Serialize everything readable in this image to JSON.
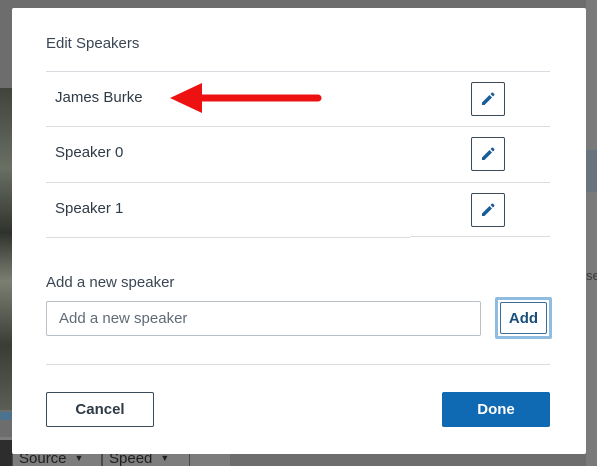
{
  "background": {
    "bottom_buttons": [
      "Source",
      "Speed"
    ],
    "right_text": "se"
  },
  "modal": {
    "title": "Edit Speakers",
    "speakers": [
      {
        "name": "James Burke",
        "edit_icon": "pencil-icon"
      },
      {
        "name": "Speaker 0",
        "edit_icon": "pencil-icon"
      },
      {
        "name": "Speaker 1",
        "edit_icon": "pencil-icon"
      }
    ],
    "add_section": {
      "label": "Add a new speaker",
      "input_placeholder": "Add a new speaker",
      "input_value": "",
      "add_button": "Add"
    },
    "footer": {
      "cancel": "Cancel",
      "done": "Done"
    }
  },
  "annotation": {
    "type": "arrow",
    "color": "#ee1111",
    "points_to": "James Burke"
  },
  "colors": {
    "primary": "#0f69b3",
    "accent_outline": "#8fbde1",
    "icon": "#1a5d99"
  }
}
